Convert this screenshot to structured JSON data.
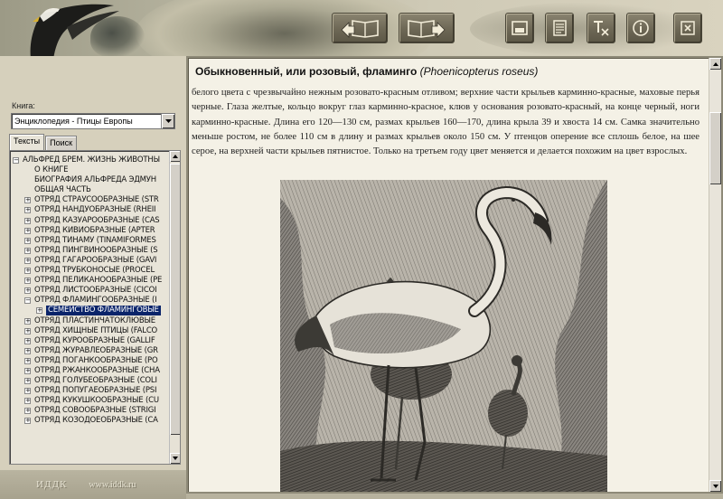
{
  "left_panel": {
    "book_label": "Книга:",
    "book_selected": "Энциклопедия - Птицы Европы",
    "tabs": [
      {
        "label": "Тексты",
        "active": true
      },
      {
        "label": "Поиск",
        "active": false
      }
    ],
    "tree": [
      {
        "label": "АЛЬФРЕД БРЕМ. ЖИЗНЬ ЖИВОТНЫ",
        "level": 0,
        "expander": "−"
      },
      {
        "label": "О КНИГЕ",
        "level": 1,
        "expander": ""
      },
      {
        "label": "БИОГРАФИЯ АЛЬФРЕДА ЭДМУН",
        "level": 1,
        "expander": ""
      },
      {
        "label": "ОБЩАЯ ЧАСТЬ",
        "level": 1,
        "expander": ""
      },
      {
        "label": "ОТРЯД СТРАУСООБРАЗНЫЕ (STR",
        "level": 1,
        "expander": "+"
      },
      {
        "label": "ОТРЯД НАНДУОБРАЗНЫЕ (RHEII",
        "level": 1,
        "expander": "+"
      },
      {
        "label": "ОТРЯД КАЗУАРООБРАЗНЫЕ (CAS",
        "level": 1,
        "expander": "+"
      },
      {
        "label": "ОТРЯД КИВИОБРАЗНЫЕ (APTER",
        "level": 1,
        "expander": "+"
      },
      {
        "label": "ОТРЯД ТИНАМУ (TINAMIFORMES",
        "level": 1,
        "expander": "+"
      },
      {
        "label": "ОТРЯД ПИНГВИНООБРАЗНЫЕ (S",
        "level": 1,
        "expander": "+"
      },
      {
        "label": "ОТРЯД ГАГАРООБРАЗНЫЕ (GAVI",
        "level": 1,
        "expander": "+"
      },
      {
        "label": "ОТРЯД ТРУБКОНОСЫЕ (PROCEL",
        "level": 1,
        "expander": "+"
      },
      {
        "label": "ОТРЯД ПЕЛИКАНООБРАЗНЫЕ (PE",
        "level": 1,
        "expander": "+"
      },
      {
        "label": "ОТРЯД ЛИСТООБРАЗНЫЕ (CICOI",
        "level": 1,
        "expander": "+"
      },
      {
        "label": "ОТРЯД ФЛАМИНГООБРАЗНЫЕ (I",
        "level": 1,
        "expander": "−"
      },
      {
        "label": "СЕМЕЙСТВО ФЛАМИНГОВЫЕ",
        "level": 2,
        "expander": "+",
        "selected": true
      },
      {
        "label": "ОТРЯД ПЛАСТИНЧАТОКЛЮВЫЕ",
        "level": 1,
        "expander": "+"
      },
      {
        "label": "ОТРЯД ХИЩНЫЕ ПТИЦЫ (FALCO",
        "level": 1,
        "expander": "+"
      },
      {
        "label": "ОТРЯД КУРООБРАЗНЫЕ (GALLIF",
        "level": 1,
        "expander": "+"
      },
      {
        "label": "ОТРЯД ЖУРАВЛЕОБРАЗНЫЕ (GR",
        "level": 1,
        "expander": "+"
      },
      {
        "label": "ОТРЯД ПОГАНКООБРАЗНЫЕ (PO",
        "level": 1,
        "expander": "+"
      },
      {
        "label": "ОТРЯД РЖАНКООБРАЗНЫЕ (CHA",
        "level": 1,
        "expander": "+"
      },
      {
        "label": "ОТРЯД ГОЛУБЕОБРАЗНЫЕ (COLI",
        "level": 1,
        "expander": "+"
      },
      {
        "label": "ОТРЯД ПОПУГАЕОБРАЗНЫЕ (PSI",
        "level": 1,
        "expander": "+"
      },
      {
        "label": "ОТРЯД КУКУШКООБРАЗНЫЕ (CU",
        "level": 1,
        "expander": "+"
      },
      {
        "label": "ОТРЯД СОВООБРАЗНЫЕ (STRIGI",
        "level": 1,
        "expander": "+"
      },
      {
        "label": "ОТРЯД КОЗОДОЕОБРАЗНЫЕ (CA",
        "level": 1,
        "expander": "+"
      }
    ]
  },
  "footer": {
    "brand": "ИДДК",
    "url": "www.iddk.ru"
  },
  "toolbar": {
    "buttons": [
      {
        "name": "back-book-button",
        "icon": "book-back-arrow-icon"
      },
      {
        "name": "forward-book-button",
        "icon": "book-forward-arrow-icon"
      },
      {
        "name": "picture-button",
        "icon": "picture-icon"
      },
      {
        "name": "notes-button",
        "icon": "notes-icon"
      },
      {
        "name": "text-format-button",
        "icon": "text-format-icon"
      },
      {
        "name": "info-button",
        "icon": "info-icon"
      },
      {
        "name": "close-button",
        "icon": "close-icon"
      }
    ]
  },
  "article": {
    "title": "Обыкновенный, или розовый, фламинго",
    "latin": "(Phoenicopterus roseus)",
    "paragraph": "белого цвета с чрезвычайно нежным розовато-красным отливом; верхние части крыльев карминно-красные, маховые перья черные. Глаза желтые, кольцо вокруг глаз карминно-красное, клюв у основания розовато-красный, на конце черный, ноги карминно-красные. Длина его 120—130 см, размах крыльев 160—170, длина крыла 39 и хвоста 14 см. Самка значительно меньше ростом, не более 110 см в длину и размах крыльев около 150 см. У птенцов оперение все сплошь белое, на шее серое, на верхней части крыльев пятнистое. Только на третьем году цвет меняется и делается похожим на цвет взрослых.",
    "figure": "flamingo-engraving"
  },
  "colors": {
    "accent_selected": "#0a246a",
    "panel": "#d6d0bc",
    "content_bg": "#f4f1e6"
  }
}
